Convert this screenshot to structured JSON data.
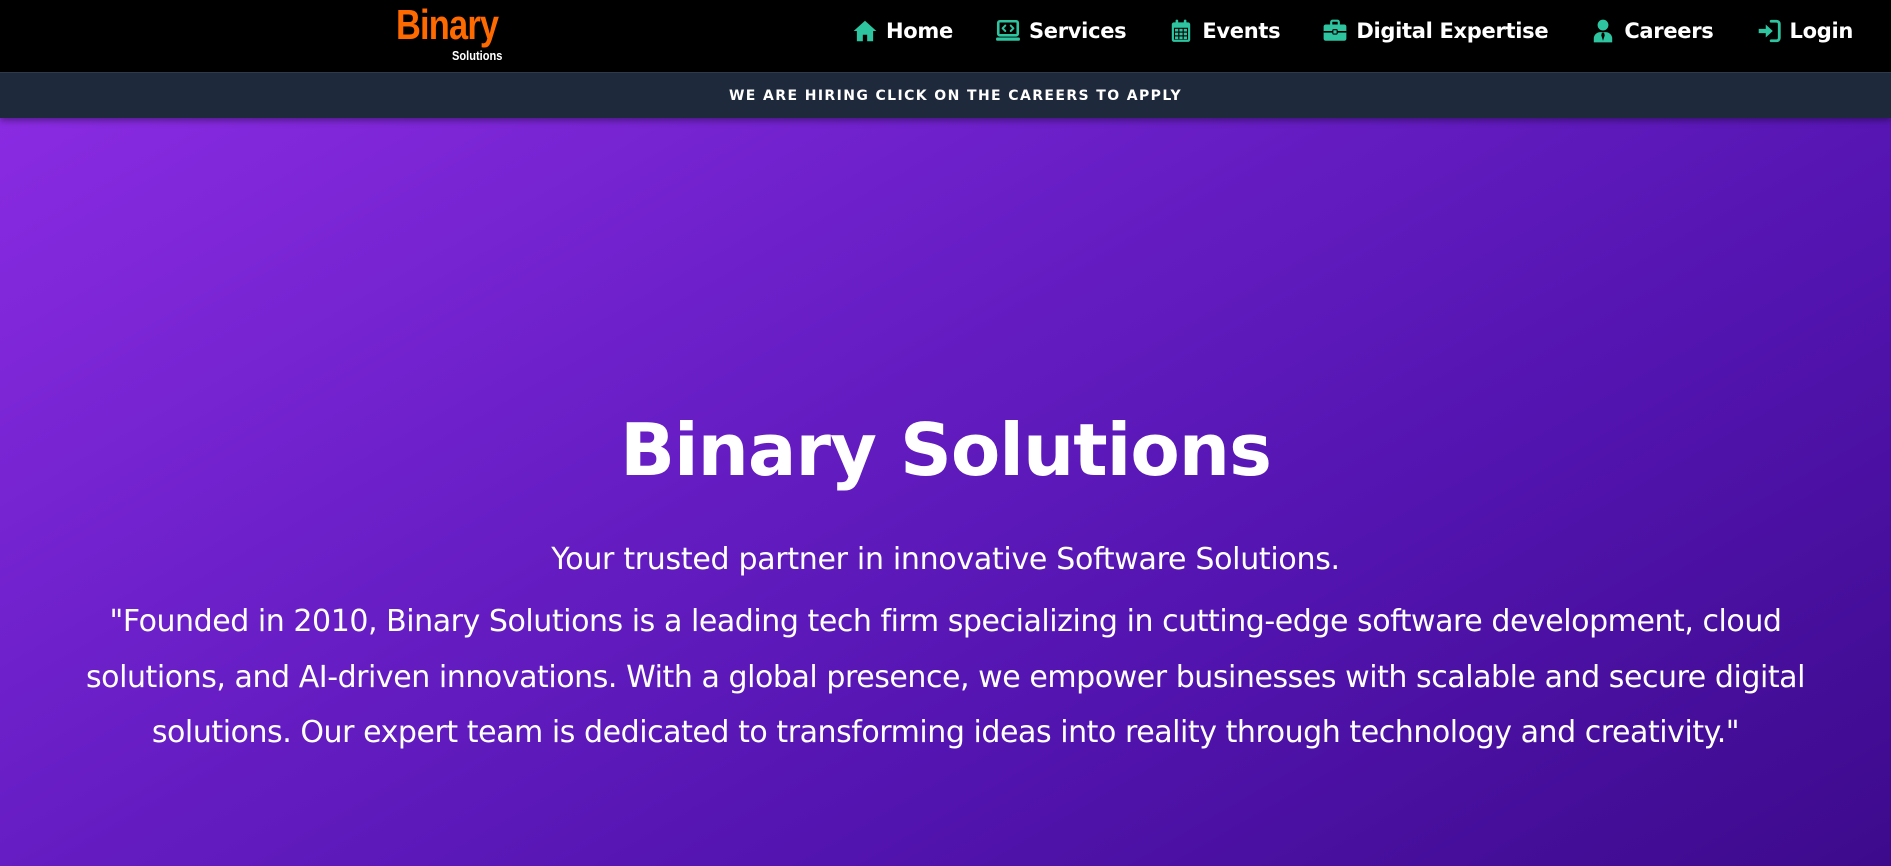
{
  "colors": {
    "accent_icon": "#2ec4a0",
    "logo_orange": "#ff6a00",
    "banner_bg": "#1e293b",
    "hero_gradient_start": "#8a2be2",
    "hero_gradient_end": "#3d0a8c"
  },
  "logo": {
    "main": "Binary",
    "sub": "Solutions"
  },
  "nav": {
    "items": [
      {
        "label": "Home",
        "icon": "home-icon"
      },
      {
        "label": "Services",
        "icon": "code-laptop-icon"
      },
      {
        "label": "Events",
        "icon": "calendar-icon"
      },
      {
        "label": "Digital Expertise",
        "icon": "briefcase-icon"
      },
      {
        "label": "Careers",
        "icon": "user-tie-icon"
      },
      {
        "label": "Login",
        "icon": "sign-in-icon"
      }
    ]
  },
  "banner": {
    "text": "WE ARE HIRING CLICK ON THE CAREERS TO APPLY"
  },
  "hero": {
    "title": "Binary Solutions",
    "subtitle": "Your trusted partner in innovative Software Solutions.",
    "description": "\"Founded in 2010, Binary Solutions is a leading tech firm specializing in cutting-edge software development, cloud solutions, and AI-driven innovations. With a global presence, we empower businesses with scalable and secure digital solutions. Our expert team is dedicated to transforming ideas into reality through technology and creativity.\""
  }
}
